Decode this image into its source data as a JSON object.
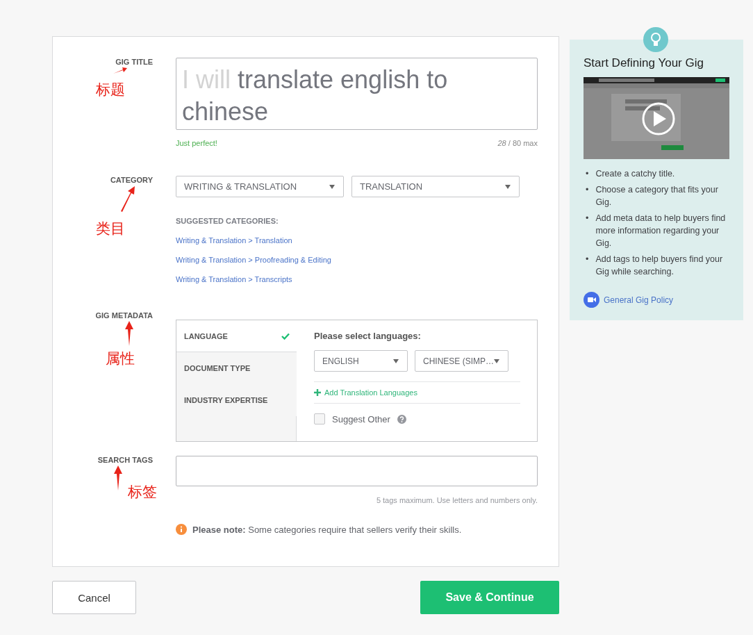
{
  "form": {
    "title_section": {
      "label": "GIG TITLE",
      "annotation": "标题",
      "prefix": "I will",
      "value": "translate english to chinese",
      "status": "Just perfect!",
      "counter": "*28* / 80 max"
    },
    "category_section": {
      "label": "CATEGORY",
      "annotation": "类目",
      "selects": [
        "WRITING & TRANSLATION",
        "TRANSLATION"
      ],
      "suggested_heading": "SUGGESTED CATEGORIES:",
      "suggestions": [
        {
          "text": "Writing & Translation > Translation"
        },
        {
          "text": "Writing & Translation > Proofreading & Editing"
        },
        {
          "text": "Writing & Translation > Transcripts"
        }
      ]
    },
    "metadata_section": {
      "label": "GIG METADATA",
      "annotation": "属性",
      "tabs": [
        {
          "label": "LANGUAGE",
          "selected": true,
          "done": true
        },
        {
          "label": "DOCUMENT TYPE",
          "selected": false,
          "done": false
        },
        {
          "label": "INDUSTRY EXPERTISE",
          "selected": false,
          "done": false
        }
      ],
      "panel": {
        "heading": "Please select languages:",
        "selects": [
          "ENGLISH",
          "CHINESE (SIMP…"
        ],
        "add_link": "Add Translation Languages",
        "suggest_other": {
          "label": "Suggest Other",
          "checked": false
        }
      }
    },
    "tags_section": {
      "label": "SEARCH TAGS",
      "annotation": "标签",
      "hint": "5 tags maximum. Use letters and numbers only."
    },
    "note": "**Please note:** Some categories require that sellers verify their skills."
  },
  "sidebar": {
    "title": "Start Defining Your Gig",
    "tips": [
      {
        "bullet": "•",
        "text": "Create a catchy title."
      },
      {
        "bullet": "•",
        "text": "Choose a category that fits your Gig."
      },
      {
        "bullet": "•",
        "text": "Add meta data to help buyers find more information regarding your Gig."
      },
      {
        "bullet": "•",
        "text": "Add tags to help buyers find your Gig while searching."
      }
    ],
    "link": "General Gig Policy"
  },
  "actions": {
    "cancel": "Cancel",
    "save": "Save & Continue"
  }
}
